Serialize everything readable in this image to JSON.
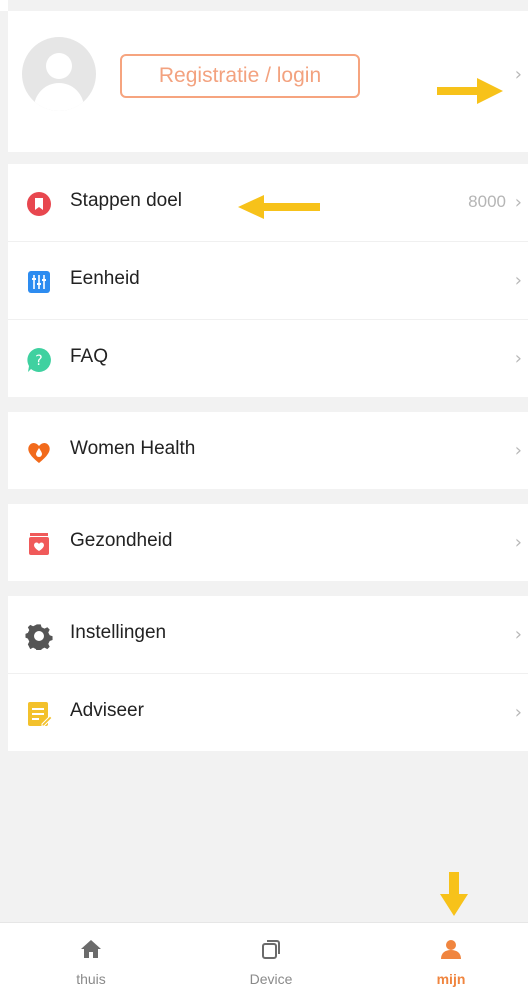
{
  "profile": {
    "login_label": "Registratie / login"
  },
  "menu": {
    "group1": [
      {
        "label": "Stappen doel",
        "value": "8000",
        "icon": "step-goal-icon"
      },
      {
        "label": "Eenheid",
        "value": "",
        "icon": "units-icon"
      },
      {
        "label": "FAQ",
        "value": "",
        "icon": "faq-icon"
      }
    ],
    "group2": [
      {
        "label": "Women Health",
        "icon": "women-health-icon"
      }
    ],
    "group3": [
      {
        "label": "Gezondheid",
        "icon": "health-icon"
      }
    ],
    "group4": [
      {
        "label": "Instellingen",
        "icon": "settings-gear-icon"
      },
      {
        "label": "Adviseer",
        "icon": "feedback-note-icon"
      }
    ]
  },
  "chevron": "›",
  "tabs": [
    {
      "label": "thuis",
      "icon": "home-icon",
      "active": false
    },
    {
      "label": "Device",
      "icon": "device-icon",
      "active": false
    },
    {
      "label": "mijn",
      "icon": "profile-icon",
      "active": true
    }
  ],
  "colors": {
    "accent": "#f0853f",
    "annotation_arrow": "#f7c21a"
  }
}
